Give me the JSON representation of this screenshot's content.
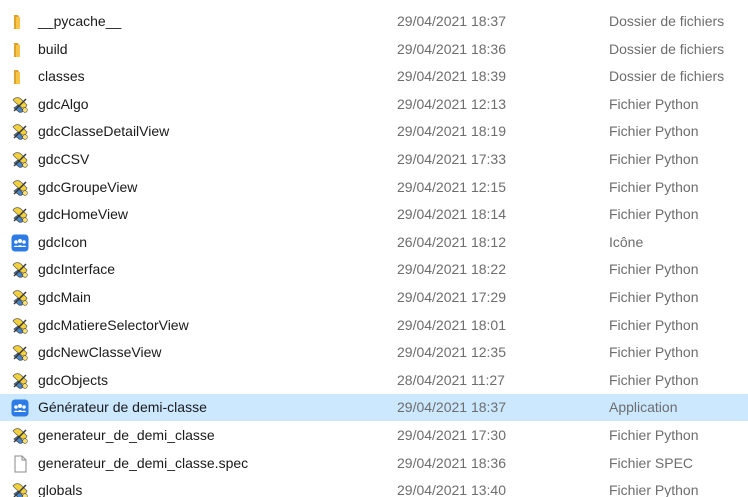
{
  "files": [
    {
      "name": "__pycache__",
      "date": "29/04/2021 18:37",
      "type": "Dossier de fichiers",
      "icon": "folder-icon"
    },
    {
      "name": "build",
      "date": "29/04/2021 18:36",
      "type": "Dossier de fichiers",
      "icon": "folder-icon"
    },
    {
      "name": "classes",
      "date": "29/04/2021 18:39",
      "type": "Dossier de fichiers",
      "icon": "folder-icon"
    },
    {
      "name": "gdcAlgo",
      "date": "29/04/2021 12:13",
      "type": "Fichier Python",
      "icon": "python-file-icon"
    },
    {
      "name": "gdcClasseDetailView",
      "date": "29/04/2021 18:19",
      "type": "Fichier Python",
      "icon": "python-file-icon"
    },
    {
      "name": "gdcCSV",
      "date": "29/04/2021 17:33",
      "type": "Fichier Python",
      "icon": "python-file-icon"
    },
    {
      "name": "gdcGroupeView",
      "date": "29/04/2021 12:15",
      "type": "Fichier Python",
      "icon": "python-file-icon"
    },
    {
      "name": "gdcHomeView",
      "date": "29/04/2021 18:14",
      "type": "Fichier Python",
      "icon": "python-file-icon"
    },
    {
      "name": "gdcIcon",
      "date": "26/04/2021 18:12",
      "type": "Icône",
      "icon": "app-icon"
    },
    {
      "name": "gdcInterface",
      "date": "29/04/2021 18:22",
      "type": "Fichier Python",
      "icon": "python-file-icon"
    },
    {
      "name": "gdcMain",
      "date": "29/04/2021 17:29",
      "type": "Fichier Python",
      "icon": "python-file-icon"
    },
    {
      "name": "gdcMatiereSelectorView",
      "date": "29/04/2021 18:01",
      "type": "Fichier Python",
      "icon": "python-file-icon"
    },
    {
      "name": "gdcNewClasseView",
      "date": "29/04/2021 12:35",
      "type": "Fichier Python",
      "icon": "python-file-icon"
    },
    {
      "name": "gdcObjects",
      "date": "28/04/2021 11:27",
      "type": "Fichier Python",
      "icon": "python-file-icon"
    },
    {
      "name": "Générateur de demi-classe",
      "date": "29/04/2021 18:37",
      "type": "Application",
      "icon": "app-icon",
      "selected": true
    },
    {
      "name": "generateur_de_demi_classe",
      "date": "29/04/2021 17:30",
      "type": "Fichier Python",
      "icon": "python-file-icon"
    },
    {
      "name": "generateur_de_demi_classe.spec",
      "date": "29/04/2021 18:36",
      "type": "Fichier SPEC",
      "icon": "generic-file-icon"
    },
    {
      "name": "globals",
      "date": "29/04/2021 13:40",
      "type": "Fichier Python",
      "icon": "python-file-icon"
    }
  ],
  "colors": {
    "selection_background": "#cce8ff",
    "secondary_text": "#6d6d6d",
    "folder": "#f7c548",
    "app_icon": "#2d7be5"
  }
}
